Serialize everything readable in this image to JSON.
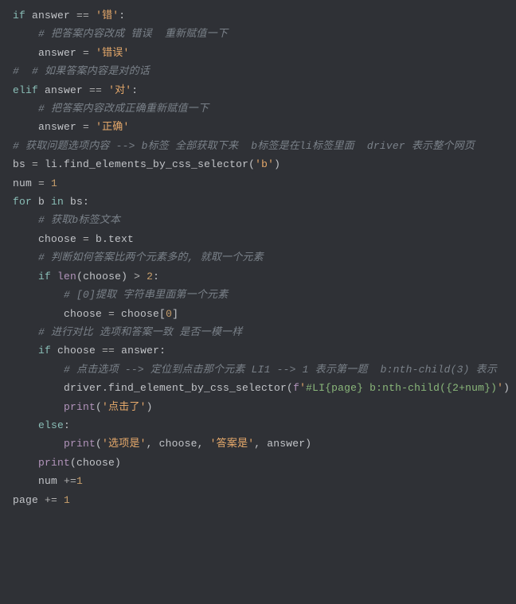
{
  "chart_data": {
    "type": "table",
    "language": "python",
    "lines": [
      {
        "indent": 0,
        "tokens": [
          [
            "key",
            "if"
          ],
          [
            "plain",
            " answer "
          ],
          [
            "op",
            "=="
          ],
          [
            "plain",
            " "
          ],
          [
            "str",
            "'错'"
          ],
          [
            "plain",
            ":"
          ]
        ]
      },
      {
        "indent": 1,
        "tokens": [
          [
            "comment",
            "# 把答案内容改成 错误  重新赋值一下"
          ]
        ]
      },
      {
        "indent": 1,
        "tokens": [
          [
            "plain",
            "answer "
          ],
          [
            "op",
            "="
          ],
          [
            "plain",
            " "
          ],
          [
            "str",
            "'错误'"
          ]
        ]
      },
      {
        "indent": 0,
        "tokens": [
          [
            "comment",
            "#  # 如果答案内容是对的话"
          ]
        ]
      },
      {
        "indent": 0,
        "tokens": [
          [
            "key",
            "elif"
          ],
          [
            "plain",
            " answer "
          ],
          [
            "op",
            "=="
          ],
          [
            "plain",
            " "
          ],
          [
            "str",
            "'对'"
          ],
          [
            "plain",
            ":"
          ]
        ]
      },
      {
        "indent": 1,
        "tokens": [
          [
            "comment",
            "# 把答案内容改成正确重新赋值一下"
          ]
        ]
      },
      {
        "indent": 1,
        "tokens": [
          [
            "plain",
            "answer "
          ],
          [
            "op",
            "="
          ],
          [
            "plain",
            " "
          ],
          [
            "str",
            "'正确'"
          ]
        ]
      },
      {
        "indent": 0,
        "tokens": [
          [
            "comment",
            "# 获取问题选项内容 --> b标签 全部获取下来  b标签是在li标签里面  driver 表示整个网页"
          ]
        ]
      },
      {
        "indent": 0,
        "tokens": [
          [
            "plain",
            "bs "
          ],
          [
            "op",
            "="
          ],
          [
            "plain",
            " li.find_elements_by_css_selector("
          ],
          [
            "str",
            "'b'"
          ],
          [
            "plain",
            ")"
          ]
        ]
      },
      {
        "indent": 0,
        "tokens": [
          [
            "plain",
            "num "
          ],
          [
            "op",
            "="
          ],
          [
            "plain",
            " "
          ],
          [
            "num",
            "1"
          ]
        ]
      },
      {
        "indent": 0,
        "tokens": [
          [
            "key",
            "for"
          ],
          [
            "plain",
            " b "
          ],
          [
            "key",
            "in"
          ],
          [
            "plain",
            " bs:"
          ]
        ]
      },
      {
        "indent": 1,
        "tokens": [
          [
            "comment",
            "# 获取b标签文本"
          ]
        ]
      },
      {
        "indent": 1,
        "tokens": [
          [
            "plain",
            "choose "
          ],
          [
            "op",
            "="
          ],
          [
            "plain",
            " b.text"
          ]
        ]
      },
      {
        "indent": 1,
        "tokens": [
          [
            "comment",
            "# 判断如何答案比两个元素多的, 就取一个元素"
          ]
        ]
      },
      {
        "indent": 1,
        "tokens": [
          [
            "key",
            "if"
          ],
          [
            "plain",
            " "
          ],
          [
            "key2",
            "len"
          ],
          [
            "plain",
            "(choose) "
          ],
          [
            "op",
            ">"
          ],
          [
            "plain",
            " "
          ],
          [
            "num",
            "2"
          ],
          [
            "plain",
            ":"
          ]
        ]
      },
      {
        "indent": 2,
        "tokens": [
          [
            "comment",
            "# [0]提取 字符串里面第一个元素"
          ]
        ]
      },
      {
        "indent": 2,
        "tokens": [
          [
            "plain",
            "choose "
          ],
          [
            "op",
            "="
          ],
          [
            "plain",
            " choose["
          ],
          [
            "num",
            "0"
          ],
          [
            "plain",
            "]"
          ]
        ]
      },
      {
        "indent": 1,
        "tokens": [
          [
            "comment",
            "# 进行对比 选项和答案一致 是否一模一样"
          ]
        ]
      },
      {
        "indent": 1,
        "tokens": [
          [
            "key",
            "if"
          ],
          [
            "plain",
            " choose "
          ],
          [
            "op",
            "=="
          ],
          [
            "plain",
            " answer:"
          ]
        ]
      },
      {
        "indent": 2,
        "tokens": [
          [
            "comment",
            "# 点击选项 --> 定位到点击那个元素 LI1 --> 1 表示第一题  b:nth-child(3) 表示"
          ]
        ]
      },
      {
        "indent": 2,
        "tokens": [
          [
            "plain",
            "driver.find_element_by_css_selector("
          ],
          [
            "key2",
            "f"
          ],
          [
            "str",
            "'"
          ],
          [
            "strg",
            "#LI{page} b:nth-child({2+num})"
          ],
          [
            "str",
            "'"
          ],
          [
            "plain",
            ")"
          ]
        ]
      },
      {
        "indent": 2,
        "tokens": [
          [
            "key2",
            "print"
          ],
          [
            "plain",
            "("
          ],
          [
            "str",
            "'点击了'"
          ],
          [
            "plain",
            ")"
          ]
        ]
      },
      {
        "indent": 1,
        "tokens": [
          [
            "key",
            "else"
          ],
          [
            "plain",
            ":"
          ]
        ]
      },
      {
        "indent": 2,
        "tokens": [
          [
            "key2",
            "print"
          ],
          [
            "plain",
            "("
          ],
          [
            "str",
            "'选项是'"
          ],
          [
            "plain",
            ", choose, "
          ],
          [
            "str",
            "'答案是'"
          ],
          [
            "plain",
            ", answer)"
          ]
        ]
      },
      {
        "indent": 1,
        "tokens": [
          [
            "key2",
            "print"
          ],
          [
            "plain",
            "(choose)"
          ]
        ]
      },
      {
        "indent": 1,
        "tokens": [
          [
            "plain",
            "num "
          ],
          [
            "op",
            "+="
          ],
          [
            "num",
            "1"
          ]
        ]
      },
      {
        "indent": 0,
        "tokens": [
          [
            "plain",
            "page "
          ],
          [
            "op",
            "+="
          ],
          [
            "plain",
            " "
          ],
          [
            "num",
            "1"
          ]
        ]
      }
    ]
  },
  "style": {
    "indent_unit": "    "
  }
}
